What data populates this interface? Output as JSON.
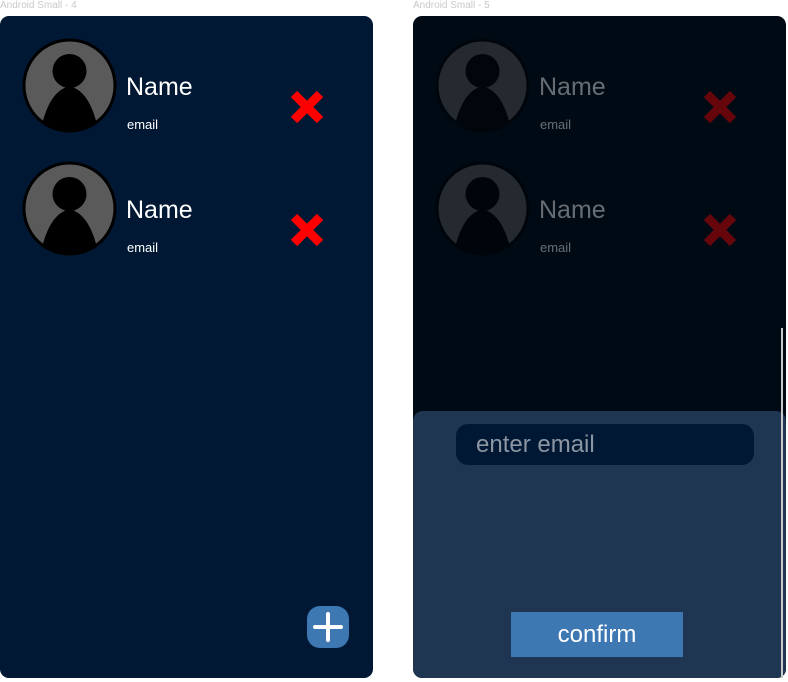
{
  "frames": [
    {
      "label": "Android Small - 4",
      "contacts": [
        {
          "name": "Name",
          "email": "email"
        },
        {
          "name": "Name",
          "email": "email"
        }
      ]
    },
    {
      "label": "Android Small - 5",
      "contacts": [
        {
          "name": "Name",
          "email": "email"
        },
        {
          "name": "Name",
          "email": "email"
        }
      ],
      "sheet": {
        "email_placeholder": "enter email",
        "confirm_label": "confirm"
      }
    }
  ],
  "icons": {
    "avatar": "person-avatar-icon",
    "remove": "red-x-icon",
    "add": "plus-icon"
  },
  "colors": {
    "background": "#001833",
    "dimmed_background": "#000a14",
    "sheet": "#1e3652",
    "accent": "#3d78b3",
    "remove": "#ff0000",
    "avatar_bg": "#5a5a5a"
  }
}
